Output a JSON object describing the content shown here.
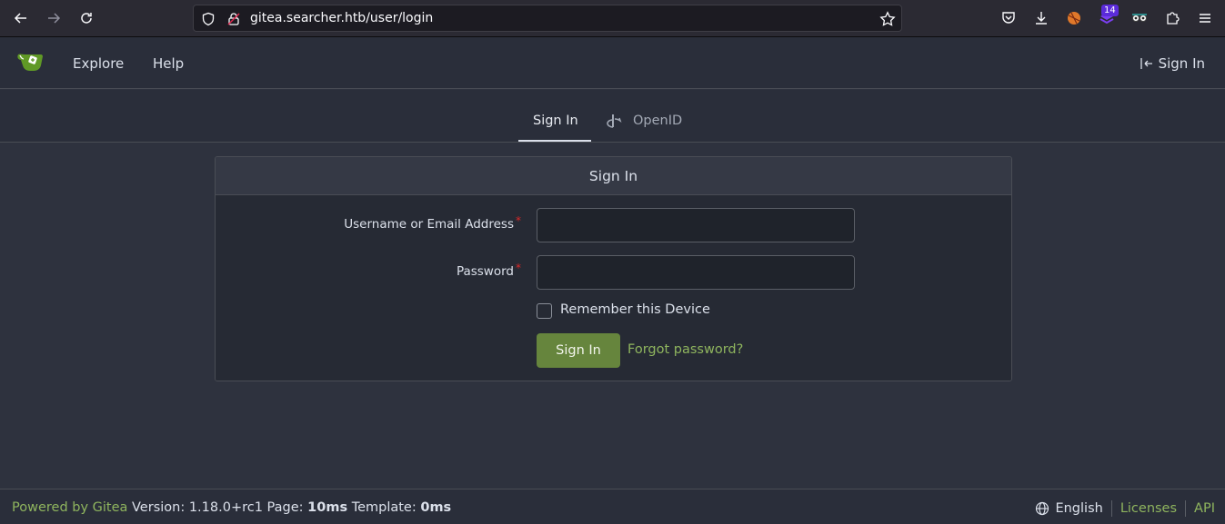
{
  "browser": {
    "url": "gitea.searcher.htb/user/login",
    "extension_badge": "14"
  },
  "header": {
    "nav": [
      "Explore",
      "Help"
    ],
    "signin_label": "Sign In"
  },
  "tabs": [
    {
      "label": "Sign In",
      "active": true
    },
    {
      "label": "OpenID",
      "active": false
    }
  ],
  "form": {
    "title": "Sign In",
    "username_label": "Username or Email Address",
    "password_label": "Password",
    "required_mark": "*",
    "username_value": "",
    "password_value": "",
    "remember_label": "Remember this Device",
    "submit_label": "Sign In",
    "forgot_label": "Forgot password?"
  },
  "footer": {
    "powered_by": "Powered by Gitea",
    "version_text": "Version: 1.18.0+rc1 Page:",
    "page_time": "10ms",
    "template_label": "Template:",
    "template_time": "0ms",
    "language": "English",
    "licenses": "Licenses",
    "api": "API"
  },
  "colors": {
    "accent_green": "#66853d",
    "link_green": "#8fb55e",
    "required_red": "#db2828"
  }
}
